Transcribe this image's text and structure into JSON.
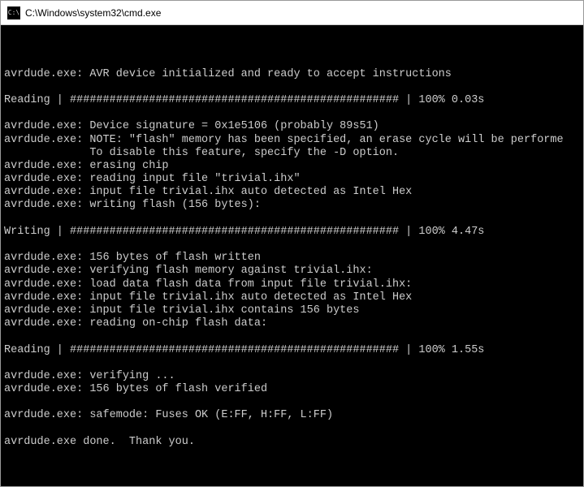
{
  "window": {
    "title": "C:\\Windows\\system32\\cmd.exe",
    "icon_label": "C:\\"
  },
  "terminal": {
    "lines": [
      "",
      "avrdude.exe: AVR device initialized and ready to accept instructions",
      "",
      "Reading | ################################################## | 100% 0.03s",
      "",
      "avrdude.exe: Device signature = 0x1e5106 (probably 89s51)",
      "avrdude.exe: NOTE: \"flash\" memory has been specified, an erase cycle will be performe",
      "             To disable this feature, specify the -D option.",
      "avrdude.exe: erasing chip",
      "avrdude.exe: reading input file \"trivial.ihx\"",
      "avrdude.exe: input file trivial.ihx auto detected as Intel Hex",
      "avrdude.exe: writing flash (156 bytes):",
      "",
      "Writing | ################################################## | 100% 4.47s",
      "",
      "avrdude.exe: 156 bytes of flash written",
      "avrdude.exe: verifying flash memory against trivial.ihx:",
      "avrdude.exe: load data flash data from input file trivial.ihx:",
      "avrdude.exe: input file trivial.ihx auto detected as Intel Hex",
      "avrdude.exe: input file trivial.ihx contains 156 bytes",
      "avrdude.exe: reading on-chip flash data:",
      "",
      "Reading | ################################################## | 100% 1.55s",
      "",
      "avrdude.exe: verifying ...",
      "avrdude.exe: 156 bytes of flash verified",
      "",
      "avrdude.exe: safemode: Fuses OK (E:FF, H:FF, L:FF)",
      "",
      "avrdude.exe done.  Thank you."
    ]
  }
}
